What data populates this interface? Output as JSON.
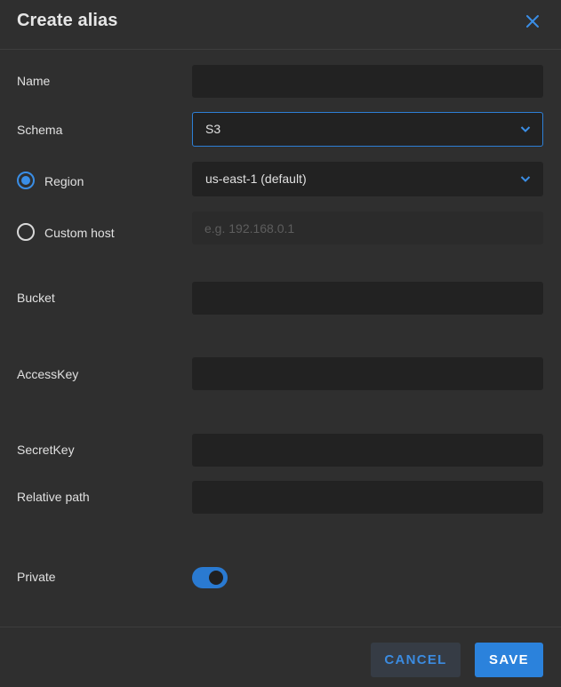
{
  "dialog": {
    "title": "Create alias",
    "close_icon": "close-icon"
  },
  "form": {
    "name": {
      "label": "Name",
      "value": ""
    },
    "schema": {
      "label": "Schema",
      "value": "S3"
    },
    "region": {
      "label": "Region",
      "value": "us-east-1 (default)",
      "selected": true
    },
    "custom_host": {
      "label": "Custom host",
      "placeholder": "e.g. 192.168.0.1",
      "selected": false
    },
    "bucket": {
      "label": "Bucket",
      "value": ""
    },
    "access_key": {
      "label": "AccessKey",
      "value": ""
    },
    "secret_key": {
      "label": "SecretKey",
      "value": ""
    },
    "relative_path": {
      "label": "Relative path",
      "value": ""
    },
    "private": {
      "label": "Private",
      "enabled": true
    }
  },
  "footer": {
    "cancel_label": "CANCEL",
    "save_label": "SAVE"
  },
  "colors": {
    "accent": "#2b82dc",
    "background": "#2f2f2f",
    "field": "#222222"
  }
}
